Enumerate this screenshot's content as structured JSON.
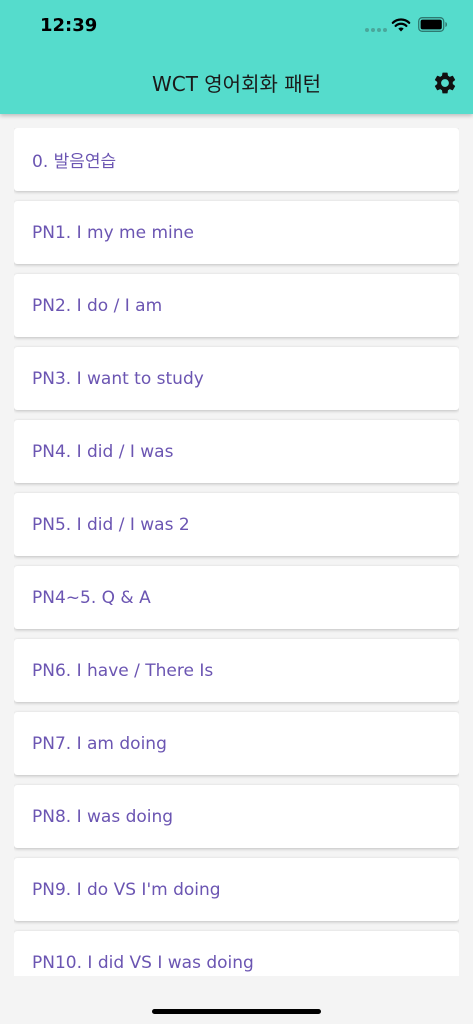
{
  "status_bar": {
    "time": "12:39"
  },
  "header": {
    "title": "WCT 영어회화 패턴"
  },
  "items": [
    {
      "label": "0. 발음연습"
    },
    {
      "label": "PN1. I my me mine"
    },
    {
      "label": "PN2. I do / I am"
    },
    {
      "label": "PN3. I want to study"
    },
    {
      "label": "PN4. I did / I was"
    },
    {
      "label": "PN5. I did / I was 2"
    },
    {
      "label": "PN4~5. Q & A"
    },
    {
      "label": "PN6. I have / There Is"
    },
    {
      "label": "PN7. I am doing"
    },
    {
      "label": "PN8. I was doing"
    },
    {
      "label": "PN9. I do VS I'm doing"
    },
    {
      "label": "PN10. I did VS I was doing"
    }
  ],
  "icons": {
    "settings": "gear-icon",
    "wifi": "wifi-icon",
    "battery": "battery-icon",
    "signal": "signal-icon"
  },
  "colors": {
    "header_background": "#55dccc",
    "item_text": "#6b55b2",
    "list_background": "#f4f4f4"
  }
}
